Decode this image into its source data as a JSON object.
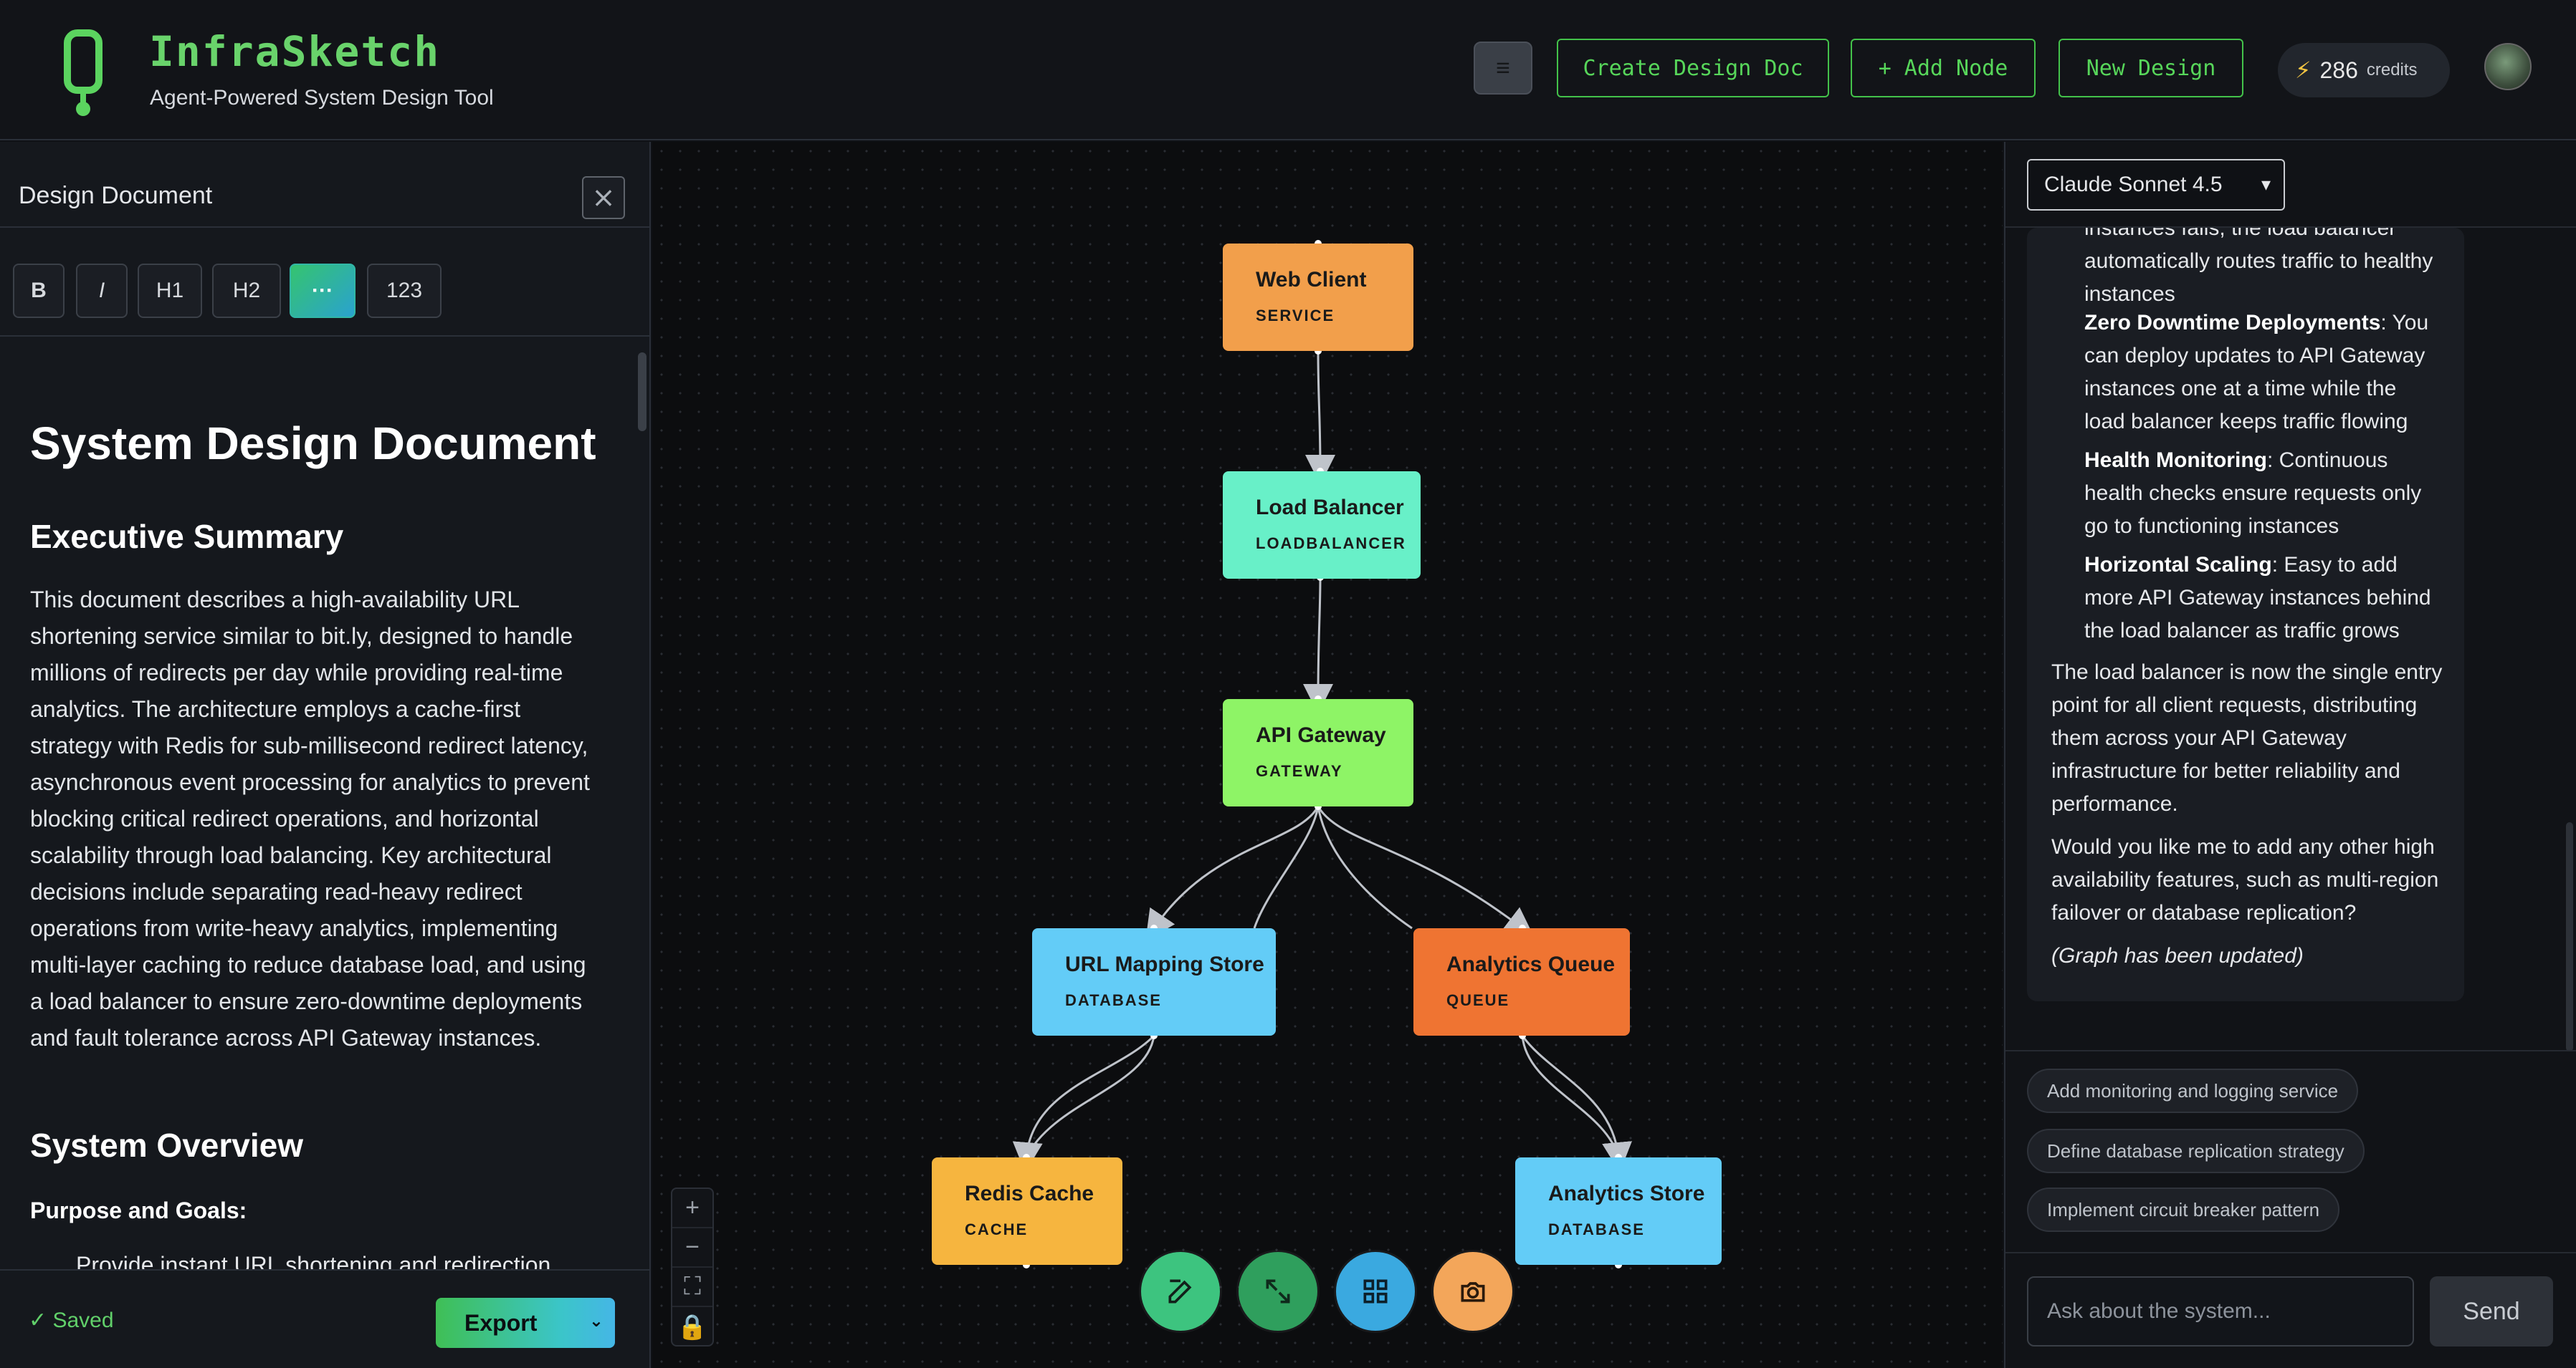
{
  "app": {
    "name": "InfraSketch",
    "tagline": "Agent-Powered System Design Tool"
  },
  "toolbar": {
    "menu_icon": "≡",
    "create_doc": "Create Design Doc",
    "add_node": "+ Add Node",
    "new_design": "New Design",
    "credits_value": "286",
    "credits_label": "credits",
    "credits_icon": "⚡"
  },
  "left_panel": {
    "title": "Design Document",
    "close": "⨯",
    "format_buttons": [
      "B",
      "I",
      "H1",
      "H2",
      "···",
      "123"
    ],
    "doc": {
      "h1": "System Design Document",
      "exec_title": "Executive Summary",
      "exec_text": "This document describes a high-availability URL shortening service similar to bit.ly, designed to handle millions of redirects per day while providing real-time analytics. The architecture employs a cache-first strategy with Redis for sub-millisecond redirect latency, asynchronous event processing for analytics to prevent blocking critical redirect operations, and horizontal scalability through load balancing. Key architectural decisions include separating read-heavy redirect operations from write-heavy analytics, implementing multi-layer caching to reduce database load, and using a load balancer to ensure zero-downtime deployments and fault tolerance across API Gateway instances.",
      "overview_title": "System Overview",
      "purpose_title": "Purpose and Goals:",
      "list_item_1": "Provide instant URL shortening and redirection"
    },
    "saved": "✓ Saved",
    "export": "Export",
    "export_caret": "⌄"
  },
  "graph": {
    "nodes": [
      {
        "id": "web",
        "title": "Web Client",
        "type": "SERVICE",
        "color": "#f29f4b"
      },
      {
        "id": "lb",
        "title": "Load Balancer",
        "type": "LOADBALANCER",
        "color": "#68f0c8"
      },
      {
        "id": "gw",
        "title": "API Gateway",
        "type": "GATEWAY",
        "color": "#8ef466"
      },
      {
        "id": "url",
        "title": "URL Mapping Store",
        "type": "DATABASE",
        "color": "#63ccf7"
      },
      {
        "id": "aq",
        "title": "Analytics Queue",
        "type": "QUEUE",
        "color": "#ef7432"
      },
      {
        "id": "redis",
        "title": "Redis Cache",
        "type": "CACHE",
        "color": "#f6b53f"
      },
      {
        "id": "astore",
        "title": "Analytics Store",
        "type": "DATABASE",
        "color": "#63ccf7"
      }
    ],
    "zoom_controls": [
      "+",
      "−",
      "⛶",
      "🔒"
    ]
  },
  "right_panel": {
    "model": "Claude Sonnet 4.5",
    "model_caret": "▾",
    "chat": {
      "line_a": "instances fails, the load balancer automatically routes traffic to healthy instances",
      "b1_title": "Zero Downtime Deployments",
      "b1_text": ": You can deploy updates to API Gateway instances one at a time while the load balancer keeps traffic flowing",
      "b2_title": "Health Monitoring",
      "b2_text": ": Continuous health checks ensure requests only go to functioning instances",
      "b3_title": "Horizontal Scaling",
      "b3_text": ": Easy to add more API Gateway instances behind the load balancer as traffic grows",
      "p1": "The load balancer is now the single entry point for all client requests, distributing them across your API Gateway infrastructure for better reliability and performance.",
      "p2": "Would you like me to add any other high availability features, such as multi-region failover or database replication?",
      "em": "(Graph has been updated)"
    },
    "suggestions": [
      "Add monitoring and logging service",
      "Define database replication strategy",
      "Implement circuit breaker pattern"
    ],
    "ask_placeholder": "Ask about the system...",
    "send": "Send"
  }
}
